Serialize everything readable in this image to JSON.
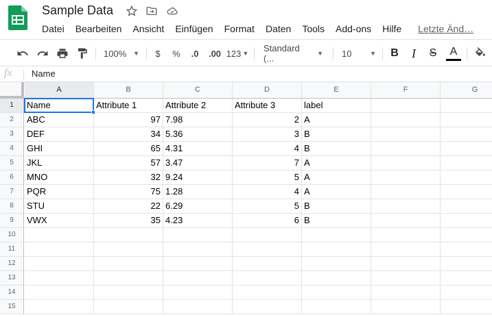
{
  "app": {
    "title": "Sample Data",
    "brand_color": "#0f9d58"
  },
  "menu": {
    "items": [
      "Datei",
      "Bearbeiten",
      "Ansicht",
      "Einfügen",
      "Format",
      "Daten",
      "Tools",
      "Add-ons",
      "Hilfe"
    ],
    "last_edit": "Letzte Änd…"
  },
  "toolbar": {
    "zoom": "100%",
    "currency": "$",
    "percent": "%",
    "decrease_decimals": ".0",
    "increase_decimals": ".00",
    "more_formats": "123",
    "font": "Standard (...",
    "font_size": "10",
    "bold": "B",
    "italic": "I",
    "strikethrough": "S",
    "text_color_letter": "A",
    "text_color": "#000000"
  },
  "formula_bar": {
    "fx": "fx",
    "value": "Name"
  },
  "sheet": {
    "columns": [
      "A",
      "B",
      "C",
      "D",
      "E",
      "F",
      "G"
    ],
    "selected_column": "A",
    "selected_row": 1,
    "row_numbers": [
      1,
      2,
      3,
      4,
      5,
      6,
      7,
      8,
      9,
      10,
      11,
      12,
      13,
      14,
      15
    ],
    "rows": [
      [
        "Name",
        "Attribute 1",
        "Attribute 2",
        "Attribute 3",
        "label"
      ],
      [
        "ABC",
        "97",
        "7.98",
        "2",
        "A"
      ],
      [
        "DEF",
        "34",
        "5.36",
        "3",
        "B"
      ],
      [
        "GHI",
        "65",
        "4.31",
        "4",
        "B"
      ],
      [
        "JKL",
        "57",
        "3.47",
        "7",
        "A"
      ],
      [
        "MNO",
        "32",
        "9.24",
        "5",
        "A"
      ],
      [
        "PQR",
        "75",
        "1.28",
        "4",
        "A"
      ],
      [
        "STU",
        "22",
        "6.29",
        "5",
        "B"
      ],
      [
        "VWX",
        "35",
        "4.23",
        "6",
        "B"
      ]
    ],
    "selection_color": "#1a73e8"
  }
}
